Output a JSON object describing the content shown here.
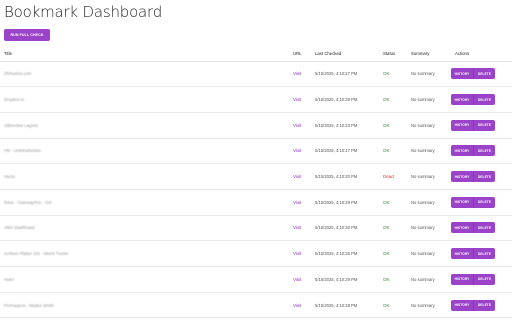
{
  "page": {
    "title": "Bookmark Dashboard"
  },
  "toolbar": {
    "run_label": "RUN FULL CHECK"
  },
  "table": {
    "headers": {
      "title": "Title",
      "url": "Visit",
      "last_checked": "Last Checked",
      "status": "Status",
      "summary": "Summary",
      "actions": "Actions"
    },
    "url_header": "URL",
    "rows": [
      {
        "title": "Zhihuidoo.com",
        "url": "Visit",
        "last_checked": "5/15/2025, 4:10:27 PM",
        "status": "OK",
        "summary": "No summary"
      },
      {
        "title": "Dropbox.io",
        "url": "Visit",
        "last_checked": "5/15/2025, 4:10:28 PM",
        "status": "OK",
        "summary": "No summary"
      },
      {
        "title": "Alibreview Lagoon",
        "url": "Visit",
        "last_checked": "5/15/2025, 4:10:23 PM",
        "status": "OK",
        "summary": "No summary"
      },
      {
        "title": "HN - Unintroduction",
        "url": "Visit",
        "last_checked": "5/15/2025, 4:10:17 PM",
        "status": "OK",
        "summary": "No summary"
      },
      {
        "title": "Hecto",
        "url": "Visit",
        "last_checked": "5/15/2025, 4:10:20 PM",
        "status": "Dead",
        "summary": "No summary"
      },
      {
        "title": "Rans - Gateway/Kin - Oct",
        "url": "Visit",
        "last_checked": "5/15/2025, 4:10:29 PM",
        "status": "OK",
        "summary": "No summary"
      },
      {
        "title": "Alkin Dashboard",
        "url": "Visit",
        "last_checked": "5/15/2025, 4:10:30 PM",
        "status": "OK",
        "summary": "No summary"
      },
      {
        "title": "Arnhem Platter 101 - Wurst Trieste",
        "url": "Visit",
        "last_checked": "5/15/2025, 4:10:25 PM",
        "status": "OK",
        "summary": "No summary"
      },
      {
        "title": "Hulel",
        "url": "Visit",
        "last_checked": "5/15/2025, 4:10:29 PM",
        "status": "OK",
        "summary": "No summary"
      },
      {
        "title": "Permaqous - Maden Smith",
        "url": "Visit",
        "last_checked": "5/15/2025, 4:10:28 PM",
        "status": "OK",
        "summary": "No summary"
      }
    ],
    "actions": {
      "history_label": "HISTORY",
      "delete_label": "DELETE"
    }
  },
  "colors": {
    "accent": "#9a43c9",
    "ok": "#2e8b3a",
    "dead": "#d43a2a",
    "link": "#8a2fb5"
  }
}
